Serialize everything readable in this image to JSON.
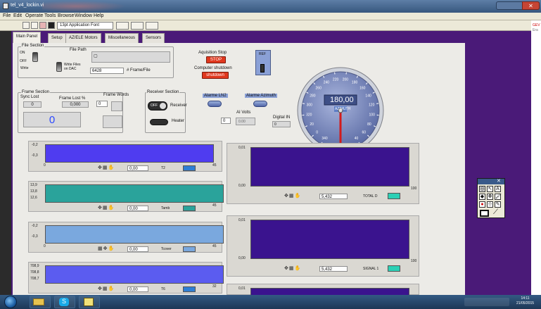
{
  "window": {
    "title": "tel_v4_lockin.vi"
  },
  "menu": [
    "File",
    "Edit",
    "Operate",
    "Tools",
    "Browse",
    "Window",
    "Help"
  ],
  "toolbar": {
    "font": "13pt Application Font"
  },
  "right_strip": {
    "err": "GEV",
    "err2": "Era"
  },
  "tabs": [
    "Main Panel",
    "Setup",
    "AZ/ELE Motors",
    "Miscellaneous",
    "Sensors"
  ],
  "file_section": {
    "title": "File Section",
    "on": "ON",
    "off": "OFF",
    "write": "Write",
    "file_path_label": "File Path",
    "write_files_label": "Write Files\non DAC",
    "frames_per_file": "6428",
    "frames_unit": "# Frame/File"
  },
  "acq": {
    "stop_label": "Aquisition Stop",
    "stop_btn": "STOP",
    "shutdown_label": "Computer shutdown",
    "shutdown_btn": "shutdown"
  },
  "ref": {
    "label": "REF"
  },
  "gauge": {
    "value": "180,00",
    "label": "AZIMUTH",
    "ticks": [
      "340",
      "0",
      "20",
      "320",
      "300",
      "280",
      "260",
      "240",
      "220",
      "200",
      "180",
      "160",
      "140",
      "120",
      "100",
      "80",
      "60",
      "40"
    ]
  },
  "frame_section": {
    "title": "Frame Section",
    "sync_lost": "Sync Lost",
    "sync_val": "0",
    "frame_lost": "Frame Lost %",
    "frame_lost_val": "0,000",
    "frame_words": "Frame Words",
    "frame_words_val": "0",
    "big_val": "0"
  },
  "receiver": {
    "title": "Receiver Section",
    "receiver": "Receiver",
    "heater": "Heater",
    "off": "OFF"
  },
  "alarms": {
    "eln": "Alarme LN2",
    "az": "Alarme Azimuth"
  },
  "ai": {
    "label": "AI Volts",
    "channel": "0",
    "value": "0.00"
  },
  "din": {
    "label": "Digital IN",
    "value": "0"
  },
  "left_charts": [
    {
      "ticks": [
        "-0,2",
        "-0,3",
        "0"
      ],
      "x_end": "45",
      "val": "0,00",
      "name": "T2",
      "color": "#4f3cf0"
    },
    {
      "ticks": [
        "13,9",
        "13,8",
        "12,6"
      ],
      "x_end": "45",
      "val": "0,00",
      "name": "Tamb",
      "color": "#2aa39b"
    },
    {
      "ticks": [
        "-0,2",
        "-0,3",
        "0"
      ],
      "x_end": "45",
      "val": "0,00",
      "name": "Tcover",
      "color": "#7aa8de"
    },
    {
      "ticks": [
        "708,9",
        "708,8",
        "708,7"
      ],
      "x_end": "32",
      "val": "0,00",
      "name": "T6",
      "color": "#5b5cf0"
    }
  ],
  "right_charts": [
    {
      "ticks": [
        "0,01",
        "0,00"
      ],
      "x_end": "100",
      "val": "5,432",
      "name": "TOTAL D",
      "color": "#3a138e"
    },
    {
      "ticks": [
        "0,01",
        "0,00"
      ],
      "x_end": "100",
      "val": "5,432",
      "name": "SIGNAL 1",
      "color": "#3a138e"
    },
    {
      "ticks": [
        "0,01"
      ],
      "x_end": "",
      "val": "",
      "name": "",
      "color": "#3a138e"
    }
  ],
  "palette": {
    "buttons": [
      "◎",
      "↖",
      "A",
      "◆",
      "✥",
      "🖌",
      "●",
      "⊹",
      "✎"
    ]
  },
  "taskbar": {
    "time": "14:11",
    "date": "21/05/2015"
  }
}
